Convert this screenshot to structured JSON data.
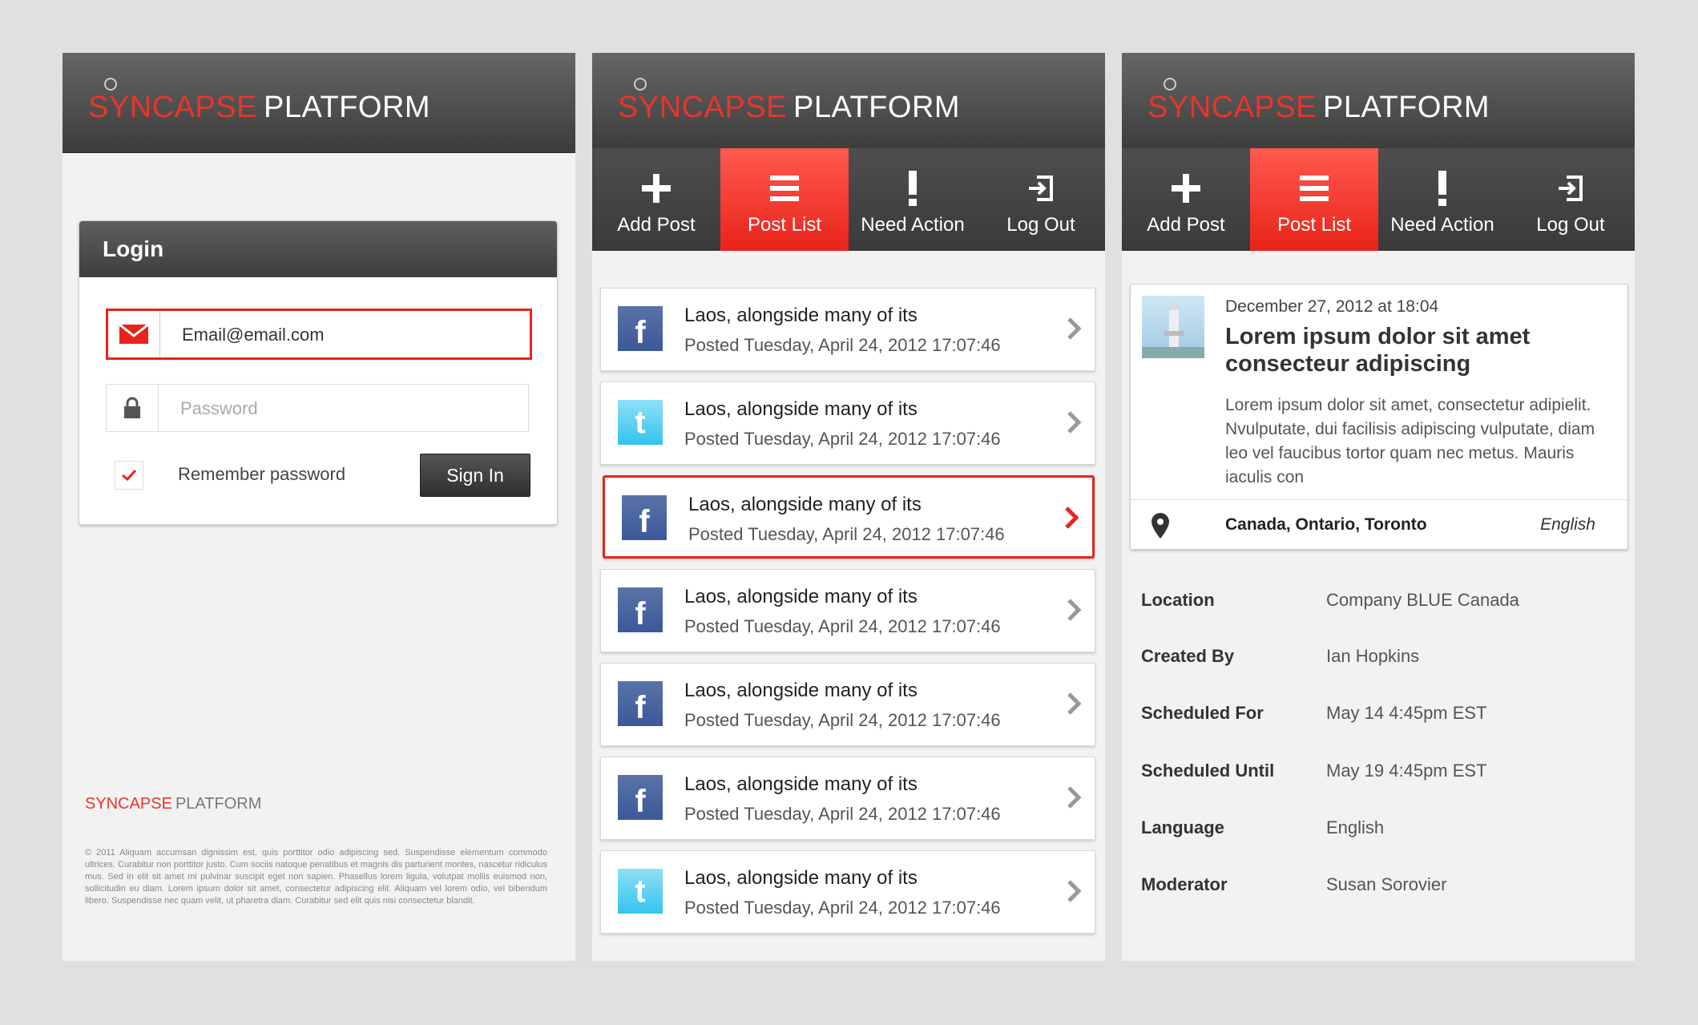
{
  "brand": {
    "syn": "SYNCAPSE",
    "plat": "PLATFORM"
  },
  "login": {
    "title": "Login",
    "email_value": "Email@email.com",
    "password_placeholder": "Password",
    "remember_label": "Remember password",
    "signin_label": "Sign In",
    "copyright": "© 2011 Aliquam accumsan dignissim est, quis porttitor odio adipiscing sed. Suspendisse elementum commodo ultrices. Curabitur non porttitor justo. Cum sociis natoque penatibus et magnis dis parturient montes, nascetur ridiculus mus. Sed in elit sit amet mi pulvinar suscipit eget non sapien. Phasellus lorem ligula, volutpat mollis euismod non, sollicitudin eu diam. Lorem ipsum dolor sit amet, consectetur adipiscing elit. Aliquam vel lorem odio, vel bibendum libero. Suspendisse nec quam velit, ut pharetra diam. Curabitur sed elit quis nisi consectetur blandit."
  },
  "nav": {
    "tabs": [
      {
        "label": "Add Post",
        "icon": "plus-icon"
      },
      {
        "label": "Post List",
        "icon": "list-icon",
        "active": true
      },
      {
        "label": "Need Action",
        "icon": "exclamation-icon"
      },
      {
        "label": "Log Out",
        "icon": "logout-icon"
      }
    ]
  },
  "posts": [
    {
      "network": "facebook",
      "title": "Laos, alongside many of its",
      "meta": "Posted Tuesday, April 24, 2012 17:07:46"
    },
    {
      "network": "twitter",
      "title": "Laos, alongside many of its",
      "meta": "Posted Tuesday, April 24, 2012 17:07:46"
    },
    {
      "network": "facebook",
      "title": "Laos, alongside many of its",
      "meta": "Posted Tuesday, April 24, 2012 17:07:46",
      "selected": true
    },
    {
      "network": "facebook",
      "title": "Laos, alongside many of its",
      "meta": "Posted Tuesday, April 24, 2012 17:07:46"
    },
    {
      "network": "facebook",
      "title": "Laos, alongside many of its",
      "meta": "Posted Tuesday, April 24, 2012 17:07:46"
    },
    {
      "network": "facebook",
      "title": "Laos, alongside many of its",
      "meta": "Posted Tuesday, April 24, 2012 17:07:46"
    },
    {
      "network": "twitter",
      "title": "Laos, alongside many of its",
      "meta": "Posted Tuesday, April 24, 2012 17:07:46"
    }
  ],
  "detail": {
    "date": "December 27, 2012 at 18:04",
    "title": "Lorem ipsum dolor sit amet consecteur adipiscing",
    "body": "Lorem ipsum dolor sit amet, consectetur adipielit. Nvulputate, dui facilisis adipiscing vulputate, diam leo vel faucibus tortor quam nec metus. Mauris iaculis con",
    "location": "Canada, Ontario, Toronto",
    "language": "English",
    "fields": [
      {
        "key": "Location",
        "value": "Company BLUE Canada"
      },
      {
        "key": "Created By",
        "value": "Ian Hopkins"
      },
      {
        "key": "Scheduled For",
        "value": "May 14 4:45pm EST"
      },
      {
        "key": "Scheduled Until",
        "value": "May 19 4:45pm EST"
      },
      {
        "key": "Language",
        "value": "English"
      },
      {
        "key": "Moderator",
        "value": "Susan Sorovier"
      }
    ]
  },
  "colors": {
    "accent": "#e8231a",
    "header": "#4a4a4a",
    "facebook": "#3b5998",
    "twitter": "#33c3ee"
  }
}
